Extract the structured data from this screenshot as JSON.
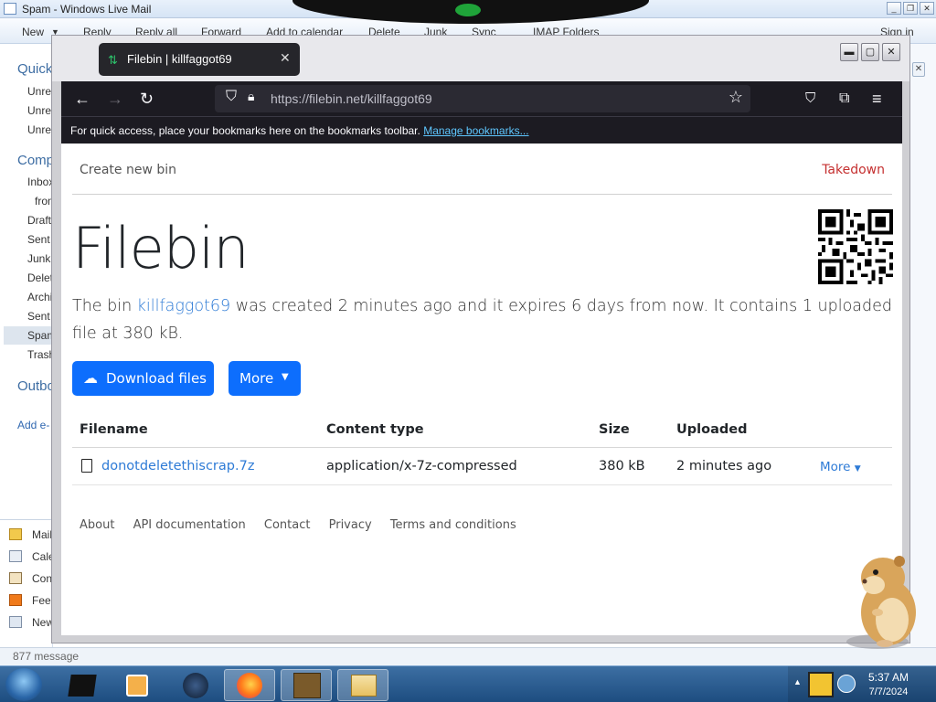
{
  "wlm": {
    "title": "Spam - Windows Live Mail",
    "ribbon": [
      "New",
      "Reply",
      "Reply all",
      "Forward",
      "Add to calendar",
      "Delete",
      "Junk",
      "Sync",
      "IMAP Folders",
      "Sign in"
    ],
    "nav": {
      "quick": "Quick",
      "quick_items": [
        "Unrea",
        "Unrea",
        "Unrea"
      ],
      "comp": "Comp",
      "comp_items": [
        "Inbox",
        "from",
        "Draft",
        "Sent",
        "Junk",
        "Delet",
        "Archi",
        "Sent",
        "Spam",
        "Trash"
      ],
      "outbox": "Outbo",
      "add": "Add e-",
      "bottom": [
        "Mail",
        "Cale",
        "Con",
        "Feed",
        "New"
      ]
    },
    "status": "877 message"
  },
  "firefox": {
    "tab_title": "Filebin | killfaggot69",
    "url": "https://filebin.net/killfaggot69",
    "bookmarks_msg": "For quick access, place your bookmarks here on the bookmarks toolbar.",
    "bookmarks_link": "Manage bookmarks..."
  },
  "page": {
    "nav_left": "Create new bin",
    "nav_right": "Takedown",
    "title": "Filebin",
    "desc": {
      "p1": "The bin ",
      "bin": "killfaggot69",
      "p2": " was created 2 minutes ago and it expires 6 days from now. It contains 1 uploaded file at 380 kB."
    },
    "download_btn": "Download files",
    "more_btn": "More",
    "table": {
      "headers": [
        "Filename",
        "Content type",
        "Size",
        "Uploaded"
      ],
      "rows": [
        {
          "filename": "donotdeletethiscrap.7z",
          "type": "application/x-7z-compressed",
          "size": "380 kB",
          "uploaded": "2 minutes ago",
          "more": "More"
        }
      ]
    },
    "footer": [
      "About",
      "API documentation",
      "Contact",
      "Privacy",
      "Terms and conditions"
    ]
  },
  "taskbar": {
    "time": "5:37 AM",
    "date": "7/7/2024"
  }
}
